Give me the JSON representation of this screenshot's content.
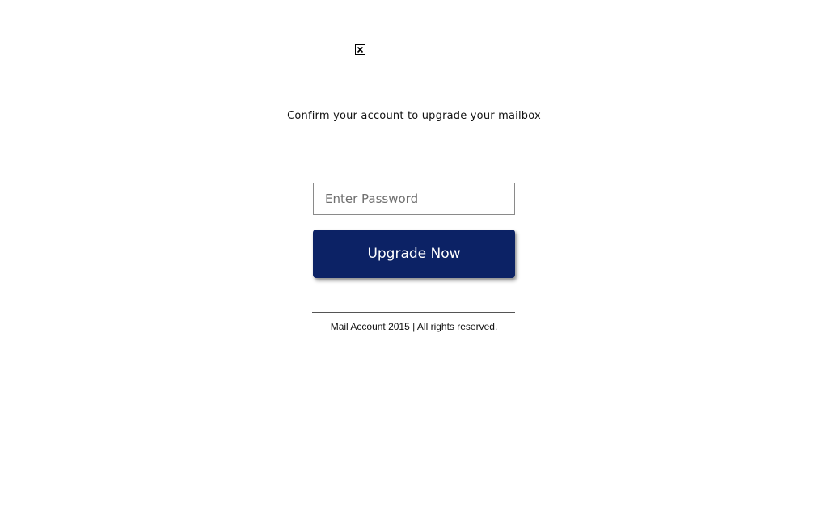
{
  "header": {
    "image_icon": "broken-image-icon",
    "headline": "Confirm your account to upgrade your mailbox"
  },
  "form": {
    "password_placeholder": "Enter Password",
    "password_value": "",
    "submit_label": "Upgrade Now"
  },
  "footer": {
    "text": "Mail Account 2015 | All rights reserved."
  },
  "colors": {
    "button_background": "#0c2265",
    "button_text": "#ffffff",
    "page_background": "#ffffff"
  }
}
